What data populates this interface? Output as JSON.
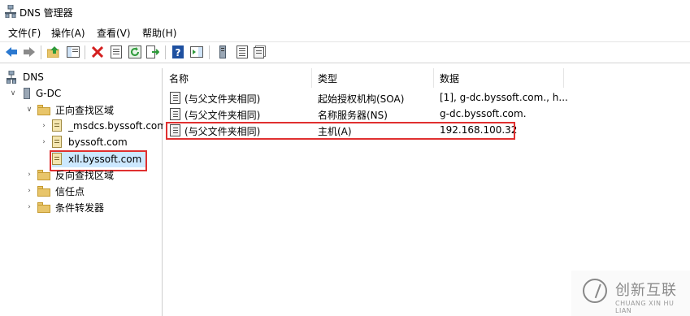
{
  "window": {
    "title": "DNS 管理器"
  },
  "menu": [
    "文件(F)",
    "操作(A)",
    "查看(V)",
    "帮助(H)"
  ],
  "toolbar": {
    "buttons": [
      "back-icon",
      "forward-icon",
      "up-folder-icon",
      "show-hide-tree-icon",
      "delete-icon",
      "properties-icon",
      "refresh-icon",
      "export-list-icon",
      "help-icon",
      "show-action-pane-icon",
      "server-icon",
      "zone-list-icon",
      "record-icon"
    ]
  },
  "tree": {
    "root": "DNS",
    "server": "G-DC",
    "forward_zones": "正向查找区域",
    "zones": [
      "_msdcs.byssoft.com",
      "byssoft.com",
      "xll.byssoft.com"
    ],
    "reverse_zones": "反向查找区域",
    "trust_points": "信任点",
    "conditional_forwarders": "条件转发器"
  },
  "list": {
    "columns": [
      "名称",
      "类型",
      "数据"
    ],
    "rows": [
      {
        "name": "(与父文件夹相同)",
        "type": "起始授权机构(SOA)",
        "data": "[1], g-dc.byssoft.com., h..."
      },
      {
        "name": "(与父文件夹相同)",
        "type": "名称服务器(NS)",
        "data": "g-dc.byssoft.com."
      },
      {
        "name": "(与父文件夹相同)",
        "type": "主机(A)",
        "data": "192.168.100.32"
      }
    ]
  },
  "watermark": {
    "cn": "创新互联",
    "en": "CHUANG XIN HU LIAN"
  },
  "colors": {
    "highlight": "#e03030",
    "selection": "#cce8ff",
    "accent": "#2b79d0"
  }
}
